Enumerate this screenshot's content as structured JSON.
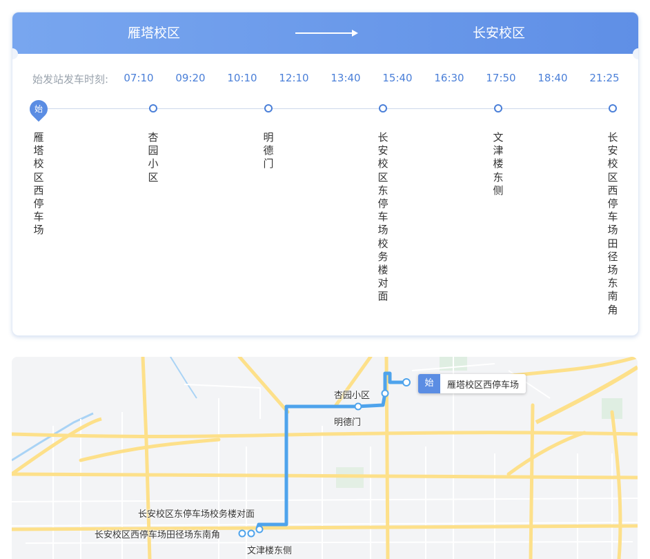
{
  "route": {
    "from": "雁塔校区",
    "to": "长安校区"
  },
  "schedule": {
    "label": "始发站发车时刻:",
    "times": [
      "07:10",
      "09:20",
      "10:10",
      "12:10",
      "13:40",
      "15:40",
      "16:30",
      "17:50",
      "18:40",
      "21:25"
    ]
  },
  "stops": [
    {
      "name": "雁塔校区西停车场",
      "marker": "始"
    },
    {
      "name": "杏园小区"
    },
    {
      "name": "明德门"
    },
    {
      "name": "长安校区东停车场校务楼对面"
    },
    {
      "name": "文津楼东侧"
    },
    {
      "name": "长安校区西停车场田径场东南角"
    }
  ],
  "map": {
    "start_badge": "始",
    "start_label": "雁塔校区西停车场",
    "labels": {
      "xingyuan": "杏园小区",
      "mingde": "明德门",
      "changan_east": "长安校区东停车场校务楼对面",
      "changan_west": "长安校区西停车场田径场东南角",
      "wenjin": "文津楼东侧"
    },
    "route_color": "#4ea3ec"
  },
  "colors": {
    "header": "#6a98ea",
    "accent": "#4a7fd8"
  },
  "icons": {
    "start": "start-pin-icon",
    "arrow": "right-arrow-icon",
    "stop": "stop-dot-icon"
  }
}
